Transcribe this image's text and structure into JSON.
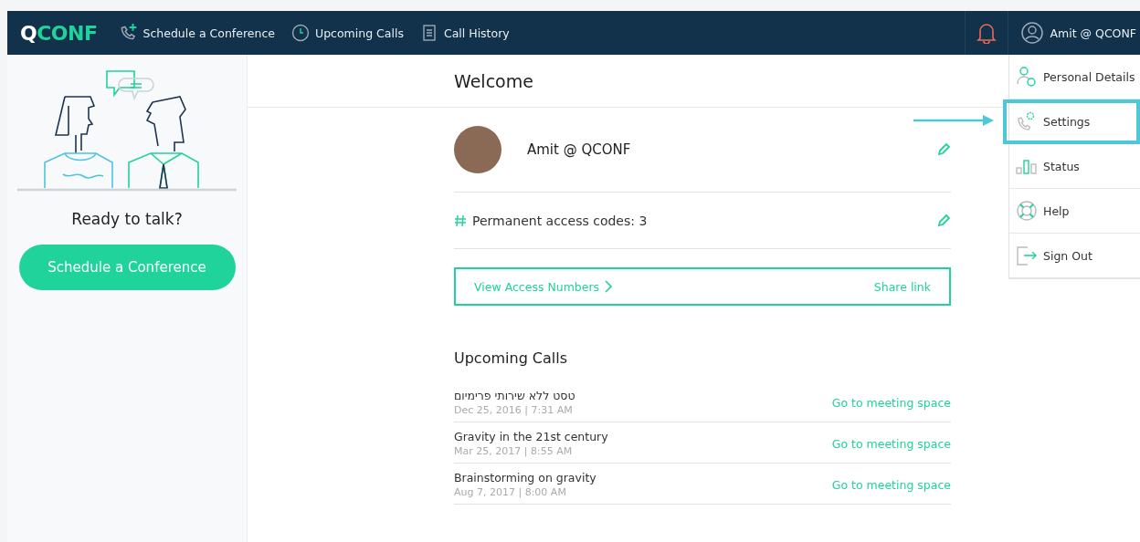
{
  "nav": {
    "logo": {
      "mark": "Q",
      "text": "CONF"
    },
    "items": [
      {
        "label": "Schedule a Conference"
      },
      {
        "label": "Upcoming Calls"
      },
      {
        "label": "Call History"
      }
    ],
    "user": "Amit @ QCONF"
  },
  "sidebar": {
    "prompt": "Ready to talk?",
    "button": "Schedule a Conference"
  },
  "welcome": {
    "title": "Welcome",
    "name": "Amit @ QCONF",
    "access_codes": "Permanent access codes: 3",
    "access_numbers": "View Access Numbers",
    "share": "Share link"
  },
  "upcoming": {
    "title": "Upcoming Calls",
    "calls": [
      {
        "title": "טסט ללא שירותי פרימיום",
        "date": "Dec 25, 2016 | 7:31 AM",
        "link": "Go to meeting space"
      },
      {
        "title": "Gravity in the 21st century",
        "date": "Mar 25, 2017 | 8:55 AM",
        "link": "Go to meeting space"
      },
      {
        "title": "Brainstorming on gravity",
        "date": "Aug 7, 2017 | 8:00 AM",
        "link": "Go to meeting space"
      }
    ]
  },
  "menu": [
    {
      "label": "Personal Details",
      "selected": false
    },
    {
      "label": "Settings",
      "selected": true
    },
    {
      "label": "Status",
      "selected": false
    },
    {
      "label": "Help",
      "selected": false
    },
    {
      "label": "Sign Out",
      "selected": false
    }
  ]
}
